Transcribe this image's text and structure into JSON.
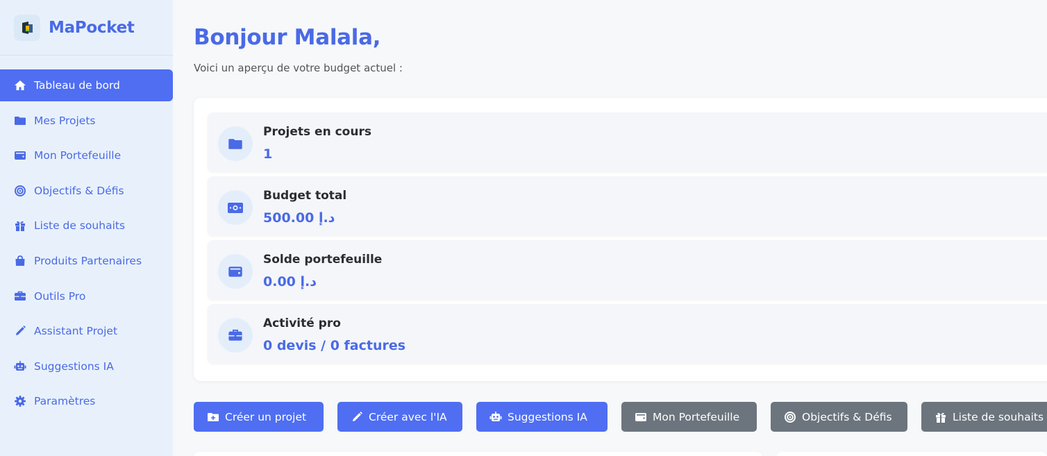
{
  "app": {
    "name": "MaPocket"
  },
  "sidebar": {
    "items": [
      {
        "label": "Tableau de bord",
        "icon": "home-icon",
        "active": true
      },
      {
        "label": "Mes Projets",
        "icon": "folder-icon"
      },
      {
        "label": "Mon Portefeuille",
        "icon": "wallet-icon"
      },
      {
        "label": "Objectifs & Défis",
        "icon": "target-icon"
      },
      {
        "label": "Liste de souhaits",
        "icon": "gift-icon"
      },
      {
        "label": "Produits Partenaires",
        "icon": "shopping-bag-icon"
      },
      {
        "label": "Outils Pro",
        "icon": "briefcase-icon"
      },
      {
        "label": "Assistant Projet",
        "icon": "pencil-icon"
      },
      {
        "label": "Suggestions IA",
        "icon": "robot-icon"
      },
      {
        "label": "Paramètres",
        "icon": "gear-icon"
      }
    ]
  },
  "header": {
    "greeting": "Bonjour Malala,",
    "subtitle": "Voici un aperçu de votre budget actuel :"
  },
  "stats": [
    {
      "label": "Projets en cours",
      "value": "1",
      "icon": "folder-icon"
    },
    {
      "label": "Budget total",
      "value": "500.00 د.إ",
      "icon": "money-bill-icon"
    },
    {
      "label": "Solde portefeuille",
      "value": "0.00 د.إ",
      "icon": "wallet-icon"
    },
    {
      "label": "Activité pro",
      "value": "0 devis / 0 factures",
      "icon": "briefcase-icon"
    }
  ],
  "actions": [
    {
      "label": "Créer un projet",
      "icon": "folder-plus-icon",
      "style": "blue"
    },
    {
      "label": "Créer avec l'IA",
      "icon": "pencil-icon",
      "style": "blue"
    },
    {
      "label": "Suggestions IA",
      "icon": "robot-icon",
      "style": "blue"
    },
    {
      "label": "Mon Portefeuille",
      "icon": "wallet-icon",
      "style": "grey"
    },
    {
      "label": "Objectifs & Défis",
      "icon": "target-icon",
      "style": "grey"
    },
    {
      "label": "Liste de souhaits",
      "icon": "gift-icon",
      "style": "grey"
    }
  ],
  "colors": {
    "accent": "#4f6ef2",
    "sidebar_bg": "#e8f1fb",
    "grey_button": "#6c757d",
    "text_dark": "#2b2d31"
  }
}
